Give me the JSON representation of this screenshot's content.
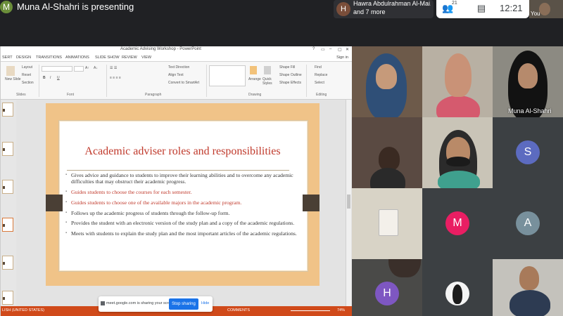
{
  "meet": {
    "presenter_initial": "M",
    "presenter_text": "Muna Al-Shahri is presenting",
    "participants_initial": "H",
    "participants_line1": "Hawra Abdulrahman Al-Mai...",
    "participants_line2": "and 7 more",
    "people_count": "21",
    "clock": "12:21",
    "self_label": "You",
    "share_notice": "meet.google.com is sharing your screen.",
    "stop_sharing": "Stop sharing",
    "hide": "Hide"
  },
  "ppt": {
    "window_title": "Academic Advising Workshop - PowerPoint",
    "window_controls": [
      "?",
      "▭",
      "–",
      "▢",
      "✕"
    ],
    "tabs": [
      "SERT",
      "DESIGN",
      "TRANSITIONS",
      "ANIMATIONS",
      "SLIDE SHOW",
      "REVIEW",
      "VIEW"
    ],
    "sign_in": "Sign in",
    "ribbon": {
      "new_slide": "New\nSlide",
      "layout": "Layout",
      "reset": "Reset",
      "section": "Section",
      "group_slides": "Slides",
      "group_font": "Font",
      "group_paragraph": "Paragraph",
      "group_drawing": "Drawing",
      "group_editing": "Editing",
      "text_direction": "Text Direction",
      "align_text": "Align Text",
      "convert_smartart": "Convert to SmartArt",
      "arrange": "Arrange",
      "quick_styles": "Quick Styles",
      "shape_fill": "Shape Fill",
      "shape_outline": "Shape Outline",
      "shape_effects": "Shape Effects",
      "find": "Find",
      "replace": "Replace",
      "select": "Select"
    },
    "slide": {
      "title": "Academic adviser roles and responsibilities",
      "bullets": [
        {
          "text": "Gives advice and guidance to students to improve their learning abilities and to overcome any academic difficulties that may obstruct their academic progress.",
          "red": false
        },
        {
          "text": "Guides students to choose the courses for each semester.",
          "red": true
        },
        {
          "text": "Guides students to choose one of the available majors in the academic program.",
          "red": true
        },
        {
          "text": "Follows up the academic progress of students through the follow-up form.",
          "red": false
        },
        {
          "text": "Provides the student with an electronic version of the study plan and a copy of the academic regulations.",
          "red": false
        },
        {
          "text": "Meets with students to explain the study plan and the most important articles of the academic regulations.",
          "red": false
        }
      ]
    },
    "status": {
      "language": "LISH (UNITED STATES)",
      "comments": "COMMENTS",
      "zoom": "74%"
    }
  },
  "grid": {
    "tiles": [
      {
        "kind": "video",
        "name": ""
      },
      {
        "kind": "video",
        "name": ""
      },
      {
        "kind": "video",
        "name": "Muna Al-Shahri"
      },
      {
        "kind": "video",
        "name": ""
      },
      {
        "kind": "video",
        "name": ""
      },
      {
        "kind": "avatar",
        "initial": "S",
        "color": "#5c6bc0"
      },
      {
        "kind": "video",
        "name": ""
      },
      {
        "kind": "avatar",
        "initial": "M",
        "color": "#e91e63"
      },
      {
        "kind": "avatar",
        "initial": "A",
        "color": "#78909c"
      },
      {
        "kind": "video",
        "name": ""
      },
      {
        "kind": "avatar",
        "initial": "H",
        "color": "#7e57c2"
      },
      {
        "kind": "avatar-photo",
        "name": ""
      },
      {
        "kind": "video",
        "name": ""
      }
    ]
  }
}
